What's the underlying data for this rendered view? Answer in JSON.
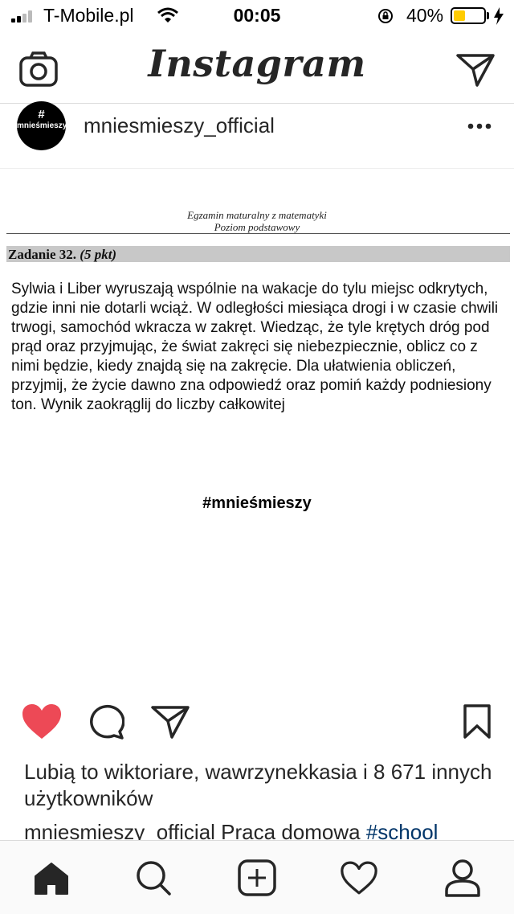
{
  "status_bar": {
    "carrier": "T-Mobile.pl",
    "time": "00:05",
    "battery_percent": "40%",
    "battery_level": 0.4,
    "battery_color": "#ffcc00"
  },
  "header": {
    "logo": "Instagram",
    "left_icon": "camera-icon",
    "right_icon": "direct-message-icon"
  },
  "post": {
    "author": "mniesmieszy_official",
    "avatar_hash": "#",
    "avatar_text": "mnieśmieszy",
    "exam_header_line1": "Egzamin maturalny z matematyki",
    "exam_header_line2": "Poziom podstawowy",
    "task_title": "Zadanie 32.",
    "task_points": "(5 pkt)",
    "task_text": "Sylwia i Liber wyruszają wspólnie na wakacje do tylu miejsc odkrytych, gdzie inni nie dotarli wciąż. W odległości miesiąca drogi i w czasie chwili trwogi, samochód wkracza w zakręt. Wiedząc, że tyle krętych dróg pod prąd oraz przyjmując, że świat zakręci się niebezpiecznie, oblicz co z nimi będzie, kiedy znajdą się na zakręcie. Dla ułatwienia obliczeń, przyjmij, że życie dawno zna odpowiedź oraz pomiń każdy podniesiony ton. Wynik zaokrąglij do liczby całkowitej",
    "image_hashtag": "#mnieśmieszy",
    "like_color": "#ed4956"
  },
  "likes": {
    "prefix": "Lubią to",
    "user1": "wiktoriare,",
    "user2": "wawrzynekkasia",
    "joiner": "i",
    "count_text": "8 671 innych użytkowników"
  },
  "caption": {
    "author": "mniesmieszy_official",
    "text": "Praca domowa",
    "tag": "#school"
  },
  "tab_bar": {
    "items": [
      "home-icon",
      "search-icon",
      "new-post-icon",
      "activity-icon",
      "profile-icon"
    ]
  }
}
